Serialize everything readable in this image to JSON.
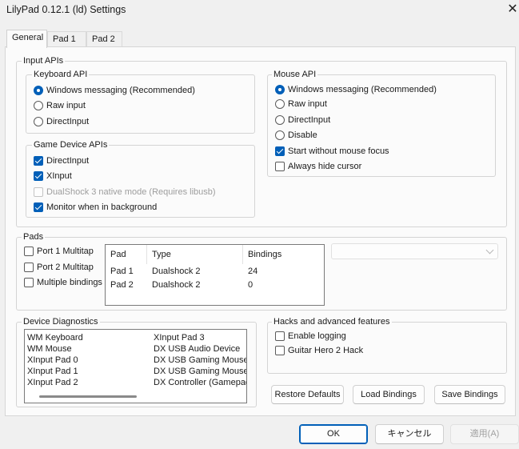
{
  "window": {
    "title": "LilyPad 0.12.1 (ld) Settings",
    "close_glyph": "✕"
  },
  "tabs": [
    {
      "label": "General"
    },
    {
      "label": "Pad 1"
    },
    {
      "label": "Pad 2"
    }
  ],
  "input_apis": {
    "legend": "Input APIs",
    "keyboard": {
      "legend": "Keyboard API",
      "options": [
        {
          "label": "Windows messaging (Recommended)",
          "selected": true
        },
        {
          "label": "Raw input",
          "selected": false
        },
        {
          "label": "DirectInput",
          "selected": false
        }
      ]
    },
    "game_device": {
      "legend": "Game Device APIs",
      "options": [
        {
          "label": "DirectInput",
          "checked": true,
          "enabled": true
        },
        {
          "label": "XInput",
          "checked": true,
          "enabled": true
        },
        {
          "label": "DualShock 3 native mode (Requires libusb)",
          "checked": false,
          "enabled": false
        },
        {
          "label": "Monitor when in background",
          "checked": true,
          "enabled": true
        }
      ]
    },
    "mouse": {
      "legend": "Mouse API",
      "options": [
        {
          "label": "Windows messaging (Recommended)",
          "selected": true
        },
        {
          "label": "Raw input",
          "selected": false
        },
        {
          "label": "DirectInput",
          "selected": false
        },
        {
          "label": "Disable",
          "selected": false
        }
      ],
      "checkboxes": [
        {
          "label": "Start without mouse focus",
          "checked": true
        },
        {
          "label": "Always hide cursor",
          "checked": false
        }
      ]
    }
  },
  "pads": {
    "legend": "Pads",
    "checkboxes": [
      {
        "label": "Port 1 Multitap",
        "checked": false
      },
      {
        "label": "Port 2 Multitap",
        "checked": false
      },
      {
        "label": "Multiple bindings",
        "checked": false
      }
    ],
    "columns": [
      "Pad",
      "Type",
      "Bindings"
    ],
    "rows": [
      [
        "Pad 1",
        "Dualshock 2",
        "24"
      ],
      [
        "Pad 2",
        "Dualshock 2",
        "0"
      ]
    ],
    "combo_value": ""
  },
  "diagnostics": {
    "legend": "Device Diagnostics",
    "col1": [
      "WM Keyboard",
      "WM Mouse",
      "XInput Pad 0",
      "XInput Pad 1",
      "XInput Pad 2"
    ],
    "col2": [
      "XInput Pad 3",
      "DX USB Audio Device",
      "DX USB Gaming Mouse",
      "DX USB Gaming Mouse",
      "DX Controller (Gamepad"
    ]
  },
  "hacks": {
    "legend": "Hacks and advanced features",
    "checkboxes": [
      {
        "label": "Enable logging",
        "checked": false
      },
      {
        "label": "Guitar Hero 2 Hack",
        "checked": false
      }
    ]
  },
  "actions": {
    "restore_defaults": "Restore Defaults",
    "load_bindings": "Load Bindings",
    "save_bindings": "Save Bindings"
  },
  "dialog_buttons": {
    "ok": "OK",
    "cancel": "キャンセル",
    "apply": "適用(A)"
  }
}
